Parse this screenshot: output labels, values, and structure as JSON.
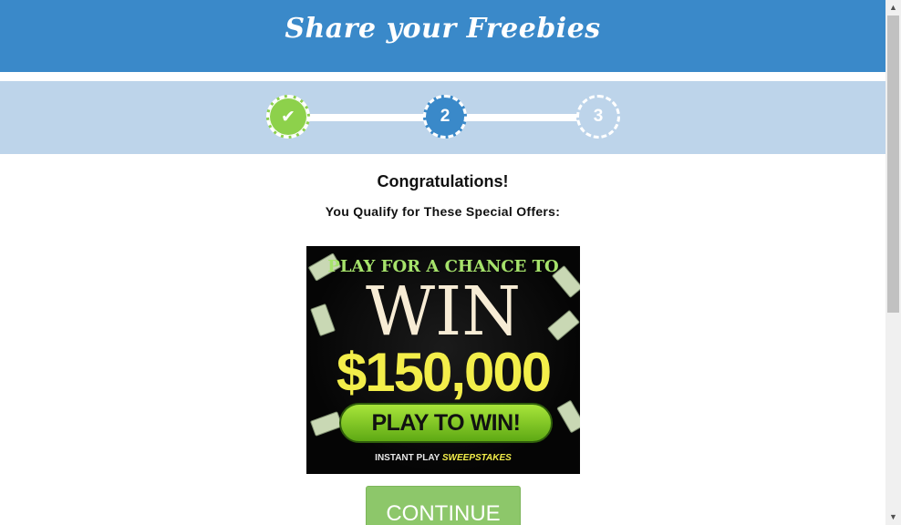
{
  "header": {
    "title": "Share your Freebies"
  },
  "steps": [
    {
      "label": "✔",
      "state": "completed"
    },
    {
      "label": "2",
      "state": "active"
    },
    {
      "label": "3",
      "state": "upcoming"
    }
  ],
  "main": {
    "heading": "Congratulations!",
    "subheading": "You Qualify for These Special Offers:"
  },
  "ad": {
    "line1": "PLAY FOR A CHANCE TO",
    "line2": "WIN",
    "amount": "$150,000",
    "button": "PLAY TO WIN!",
    "footer_prefix": "INSTANT PLAY",
    "footer_brand": "SWEEPSTAKES"
  },
  "continue_button": "CONTINUE",
  "colors": {
    "header": "#3a89c9",
    "progress_bg": "#bdd4ea",
    "step_done": "#8dd14b",
    "continue": "#8dc76a"
  }
}
